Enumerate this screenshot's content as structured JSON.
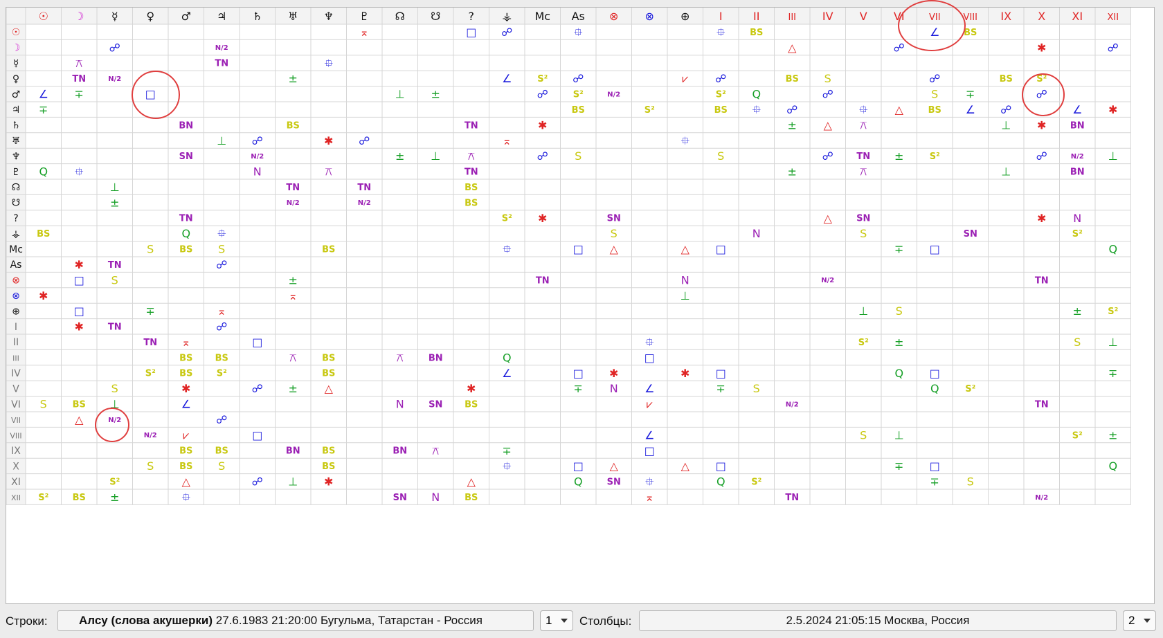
{
  "columns": [
    "☉",
    "☽",
    "☿",
    "♀",
    "♂",
    "♃",
    "♄",
    "♅",
    "♆",
    "♇",
    "☊",
    "☋",
    "?",
    "⚶",
    "Mc",
    "As",
    "⊗",
    "⊗",
    "⊕",
    "I",
    "II",
    "III",
    "IV",
    "V",
    "VI",
    "VII",
    "VIII",
    "IX",
    "X",
    "XI",
    "XII"
  ],
  "rows": [
    "☉",
    "☽",
    "☿",
    "♀",
    "♂",
    "♃",
    "♄",
    "♅",
    "♆",
    "♇",
    "☊",
    "☋",
    "?",
    "⚶",
    "Mc",
    "As",
    "⊗",
    "⊗",
    "⊕",
    "I",
    "II",
    "III",
    "IV",
    "V",
    "VI",
    "VII",
    "VIII",
    "IX",
    "X",
    "XI",
    "XII"
  ],
  "cells": [
    [
      0,
      9,
      "⌅"
    ],
    [
      0,
      12,
      "□"
    ],
    [
      0,
      13,
      "☍"
    ],
    [
      0,
      15,
      "⯐"
    ],
    [
      0,
      19,
      "⯐"
    ],
    [
      0,
      20,
      "BS"
    ],
    [
      0,
      25,
      "∠"
    ],
    [
      0,
      26,
      "BS"
    ],
    [
      1,
      2,
      "☍"
    ],
    [
      1,
      5,
      "N/2"
    ],
    [
      1,
      21,
      "△"
    ],
    [
      1,
      24,
      "☍"
    ],
    [
      1,
      28,
      "✱"
    ],
    [
      1,
      30,
      "☍"
    ],
    [
      2,
      1,
      "⚻"
    ],
    [
      2,
      5,
      "TN"
    ],
    [
      2,
      8,
      "⯐"
    ],
    [
      3,
      1,
      "TN"
    ],
    [
      3,
      2,
      "N/2"
    ],
    [
      3,
      7,
      "±"
    ],
    [
      3,
      13,
      "∠"
    ],
    [
      3,
      14,
      "S²"
    ],
    [
      3,
      15,
      "☍"
    ],
    [
      3,
      18,
      "⩗"
    ],
    [
      3,
      19,
      "☍"
    ],
    [
      3,
      21,
      "BS"
    ],
    [
      3,
      22,
      "S"
    ],
    [
      3,
      25,
      "☍"
    ],
    [
      3,
      27,
      "BS"
    ],
    [
      3,
      28,
      "S²"
    ],
    [
      4,
      0,
      "∠"
    ],
    [
      4,
      1,
      "∓"
    ],
    [
      4,
      3,
      "□"
    ],
    [
      4,
      10,
      "⊥"
    ],
    [
      4,
      11,
      "±"
    ],
    [
      4,
      14,
      "☍"
    ],
    [
      4,
      15,
      "S²"
    ],
    [
      4,
      16,
      "N/2"
    ],
    [
      4,
      19,
      "S²"
    ],
    [
      4,
      20,
      "Q"
    ],
    [
      4,
      22,
      "☍"
    ],
    [
      4,
      25,
      "S"
    ],
    [
      4,
      26,
      "∓"
    ],
    [
      4,
      28,
      "☍"
    ],
    [
      5,
      0,
      "∓"
    ],
    [
      5,
      15,
      "BS"
    ],
    [
      5,
      17,
      "S²"
    ],
    [
      5,
      19,
      "BS"
    ],
    [
      5,
      20,
      "⯐"
    ],
    [
      5,
      21,
      "☍"
    ],
    [
      5,
      23,
      "⯐"
    ],
    [
      5,
      24,
      "△"
    ],
    [
      5,
      25,
      "BS"
    ],
    [
      5,
      26,
      "∠"
    ],
    [
      5,
      27,
      "☍"
    ],
    [
      5,
      29,
      "∠"
    ],
    [
      5,
      30,
      "✱"
    ],
    [
      6,
      4,
      "BN"
    ],
    [
      6,
      7,
      "BS"
    ],
    [
      6,
      12,
      "TN"
    ],
    [
      6,
      14,
      "✱"
    ],
    [
      6,
      21,
      "±"
    ],
    [
      6,
      22,
      "△"
    ],
    [
      6,
      23,
      "⚻"
    ],
    [
      6,
      27,
      "⊥"
    ],
    [
      6,
      28,
      "✱"
    ],
    [
      6,
      29,
      "BN"
    ],
    [
      7,
      5,
      "⊥"
    ],
    [
      7,
      6,
      "☍"
    ],
    [
      7,
      8,
      "✱"
    ],
    [
      7,
      9,
      "☍"
    ],
    [
      7,
      13,
      "⌅"
    ],
    [
      7,
      18,
      "⯐"
    ],
    [
      8,
      4,
      "SN"
    ],
    [
      8,
      6,
      "N/2"
    ],
    [
      8,
      10,
      "±"
    ],
    [
      8,
      11,
      "⊥"
    ],
    [
      8,
      12,
      "⚻"
    ],
    [
      8,
      14,
      "☍"
    ],
    [
      8,
      15,
      "S"
    ],
    [
      8,
      19,
      "S"
    ],
    [
      8,
      22,
      "☍"
    ],
    [
      8,
      23,
      "TN"
    ],
    [
      8,
      24,
      "±"
    ],
    [
      8,
      25,
      "S²"
    ],
    [
      8,
      28,
      "☍"
    ],
    [
      8,
      29,
      "N/2"
    ],
    [
      8,
      30,
      "⊥"
    ],
    [
      9,
      0,
      "Q"
    ],
    [
      9,
      1,
      "⯐"
    ],
    [
      9,
      6,
      "N"
    ],
    [
      9,
      8,
      "⚻"
    ],
    [
      9,
      12,
      "TN"
    ],
    [
      9,
      21,
      "±"
    ],
    [
      9,
      23,
      "⚻"
    ],
    [
      9,
      27,
      "⊥"
    ],
    [
      9,
      29,
      "BN"
    ],
    [
      10,
      2,
      "⊥"
    ],
    [
      10,
      7,
      "TN"
    ],
    [
      10,
      9,
      "TN"
    ],
    [
      10,
      12,
      "BS"
    ],
    [
      11,
      2,
      "±"
    ],
    [
      11,
      7,
      "N/2"
    ],
    [
      11,
      9,
      "N/2"
    ],
    [
      11,
      12,
      "BS"
    ],
    [
      12,
      4,
      "TN"
    ],
    [
      12,
      13,
      "S²"
    ],
    [
      12,
      14,
      "✱"
    ],
    [
      12,
      16,
      "SN"
    ],
    [
      12,
      22,
      "△"
    ],
    [
      12,
      23,
      "SN"
    ],
    [
      12,
      28,
      "✱"
    ],
    [
      12,
      29,
      "N"
    ],
    [
      13,
      0,
      "BS"
    ],
    [
      13,
      4,
      "Q"
    ],
    [
      13,
      5,
      "⯐"
    ],
    [
      13,
      16,
      "S"
    ],
    [
      13,
      20,
      "N"
    ],
    [
      13,
      23,
      "S"
    ],
    [
      13,
      26,
      "SN"
    ],
    [
      13,
      29,
      "S²"
    ],
    [
      14,
      3,
      "S"
    ],
    [
      14,
      4,
      "BS"
    ],
    [
      14,
      5,
      "S"
    ],
    [
      14,
      8,
      "BS"
    ],
    [
      14,
      13,
      "⯐"
    ],
    [
      14,
      15,
      "□"
    ],
    [
      14,
      16,
      "△"
    ],
    [
      14,
      18,
      "△"
    ],
    [
      14,
      19,
      "□"
    ],
    [
      14,
      24,
      "∓"
    ],
    [
      14,
      25,
      "□"
    ],
    [
      14,
      30,
      "Q"
    ],
    [
      15,
      1,
      "✱"
    ],
    [
      15,
      2,
      "TN"
    ],
    [
      15,
      5,
      "☍"
    ],
    [
      16,
      1,
      "□"
    ],
    [
      16,
      2,
      "S"
    ],
    [
      16,
      7,
      "±"
    ],
    [
      16,
      14,
      "TN"
    ],
    [
      16,
      18,
      "N"
    ],
    [
      16,
      22,
      "N/2"
    ],
    [
      16,
      28,
      "TN"
    ],
    [
      17,
      0,
      "✱"
    ],
    [
      17,
      7,
      "⌅"
    ],
    [
      17,
      18,
      "⊥"
    ],
    [
      18,
      1,
      "□"
    ],
    [
      18,
      3,
      "∓"
    ],
    [
      18,
      5,
      "⌅"
    ],
    [
      18,
      23,
      "⊥"
    ],
    [
      18,
      24,
      "S"
    ],
    [
      18,
      29,
      "±"
    ],
    [
      18,
      30,
      "S²"
    ],
    [
      19,
      1,
      "✱"
    ],
    [
      19,
      2,
      "TN"
    ],
    [
      19,
      5,
      "☍"
    ],
    [
      20,
      3,
      "TN"
    ],
    [
      20,
      4,
      "⌅"
    ],
    [
      20,
      6,
      "□"
    ],
    [
      20,
      17,
      "⯐"
    ],
    [
      20,
      23,
      "S²"
    ],
    [
      20,
      24,
      "±"
    ],
    [
      20,
      29,
      "S"
    ],
    [
      20,
      30,
      "⊥"
    ],
    [
      21,
      4,
      "BS"
    ],
    [
      21,
      5,
      "BS"
    ],
    [
      21,
      7,
      "⚻"
    ],
    [
      21,
      8,
      "BS"
    ],
    [
      21,
      10,
      "⚻"
    ],
    [
      21,
      11,
      "BN"
    ],
    [
      21,
      13,
      "Q"
    ],
    [
      21,
      17,
      "□"
    ],
    [
      22,
      3,
      "S²"
    ],
    [
      22,
      4,
      "BS"
    ],
    [
      22,
      5,
      "S²"
    ],
    [
      22,
      8,
      "BS"
    ],
    [
      22,
      13,
      "∠"
    ],
    [
      22,
      15,
      "□"
    ],
    [
      22,
      16,
      "✱"
    ],
    [
      22,
      18,
      "✱"
    ],
    [
      22,
      19,
      "□"
    ],
    [
      22,
      24,
      "Q"
    ],
    [
      22,
      25,
      "□"
    ],
    [
      22,
      30,
      "∓"
    ],
    [
      23,
      2,
      "S"
    ],
    [
      23,
      4,
      "✱"
    ],
    [
      23,
      6,
      "☍"
    ],
    [
      23,
      7,
      "±"
    ],
    [
      23,
      8,
      "△"
    ],
    [
      23,
      12,
      "✱"
    ],
    [
      23,
      15,
      "∓"
    ],
    [
      23,
      16,
      "N"
    ],
    [
      23,
      17,
      "∠"
    ],
    [
      23,
      19,
      "∓"
    ],
    [
      23,
      20,
      "S"
    ],
    [
      23,
      25,
      "Q"
    ],
    [
      23,
      26,
      "S²"
    ],
    [
      24,
      0,
      "S"
    ],
    [
      24,
      1,
      "BS"
    ],
    [
      24,
      2,
      "⊥"
    ],
    [
      24,
      4,
      "∠"
    ],
    [
      24,
      10,
      "N"
    ],
    [
      24,
      11,
      "SN"
    ],
    [
      24,
      12,
      "BS"
    ],
    [
      24,
      17,
      "⩗"
    ],
    [
      24,
      21,
      "N/2"
    ],
    [
      24,
      28,
      "TN"
    ],
    [
      25,
      1,
      "△"
    ],
    [
      25,
      2,
      "N/2"
    ],
    [
      25,
      5,
      "☍"
    ],
    [
      26,
      3,
      "N/2"
    ],
    [
      26,
      4,
      "⩗"
    ],
    [
      26,
      6,
      "□"
    ],
    [
      26,
      17,
      "∠"
    ],
    [
      26,
      23,
      "S"
    ],
    [
      26,
      24,
      "⊥"
    ],
    [
      26,
      29,
      "S²"
    ],
    [
      26,
      30,
      "±"
    ],
    [
      27,
      4,
      "BS"
    ],
    [
      27,
      5,
      "BS"
    ],
    [
      27,
      7,
      "BN"
    ],
    [
      27,
      8,
      "BS"
    ],
    [
      27,
      10,
      "BN"
    ],
    [
      27,
      11,
      "⚻"
    ],
    [
      27,
      13,
      "∓"
    ],
    [
      27,
      17,
      "□"
    ],
    [
      28,
      3,
      "S"
    ],
    [
      28,
      4,
      "BS"
    ],
    [
      28,
      5,
      "S"
    ],
    [
      28,
      8,
      "BS"
    ],
    [
      28,
      13,
      "⯐"
    ],
    [
      28,
      15,
      "□"
    ],
    [
      28,
      16,
      "△"
    ],
    [
      28,
      18,
      "△"
    ],
    [
      28,
      19,
      "□"
    ],
    [
      28,
      24,
      "∓"
    ],
    [
      28,
      25,
      "□"
    ],
    [
      28,
      30,
      "Q"
    ],
    [
      29,
      2,
      "S²"
    ],
    [
      29,
      4,
      "△"
    ],
    [
      29,
      6,
      "☍"
    ],
    [
      29,
      7,
      "⊥"
    ],
    [
      29,
      8,
      "✱"
    ],
    [
      29,
      12,
      "△"
    ],
    [
      29,
      15,
      "Q"
    ],
    [
      29,
      16,
      "SN"
    ],
    [
      29,
      17,
      "⯐"
    ],
    [
      29,
      19,
      "Q"
    ],
    [
      29,
      20,
      "S²"
    ],
    [
      29,
      25,
      "∓"
    ],
    [
      29,
      26,
      "S"
    ],
    [
      30,
      0,
      "S²"
    ],
    [
      30,
      1,
      "BS"
    ],
    [
      30,
      2,
      "±"
    ],
    [
      30,
      4,
      "⯐"
    ],
    [
      30,
      10,
      "SN"
    ],
    [
      30,
      11,
      "N"
    ],
    [
      30,
      12,
      "BS"
    ],
    [
      30,
      17,
      "⌅"
    ],
    [
      30,
      21,
      "TN"
    ],
    [
      30,
      28,
      "N/2"
    ]
  ],
  "symbol_colors": {
    "□": "#1a1adc",
    "☍": "#1a1adc",
    "⯐": "#1a1adc",
    "∠": "#1a1adc",
    "✱": "#e02525",
    "△": "#e02525",
    "⌅": "#e02525",
    "⩗": "#e02525",
    "±": "#18a028",
    "∓": "#18a028",
    "⊥": "#18a028",
    "Q": "#18a028",
    "TN": "#9b20b4",
    "N/2": "#9b20b4",
    "⚻": "#9b20b4",
    "BN": "#9b20b4",
    "SN": "#9b20b4",
    "N": "#9b20b4",
    "S": "#c8c810",
    "S²": "#c8c810",
    "BS": "#c8c810"
  },
  "column_colors": {
    "planets": "#111111",
    "houses": "#e02525",
    "moon": "#d020d0",
    "sun": "#e02525",
    "pof": "#e02525",
    "vertex": "#1a1adc"
  },
  "bottom_bar": {
    "rows_label": "Строки:",
    "rows_name": "Алсу (слова акушерки)",
    "rows_details": " 27.6.1983 21:20:00 Бугульма, Татарстан - Россия",
    "rows_selector": "1",
    "cols_label": "Столбцы:",
    "cols_details": "2.5.2024 21:05:15 Москва, Россия",
    "cols_selector": "2"
  }
}
